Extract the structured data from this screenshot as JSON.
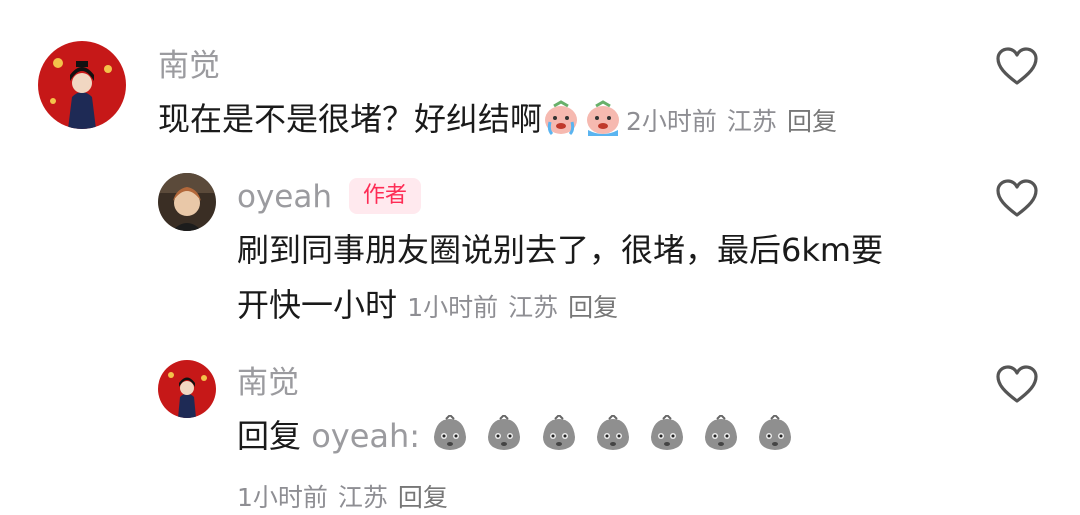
{
  "comments": [
    {
      "username": "南觉",
      "text": "现在是不是很堵？好纠结啊",
      "emojis": [
        "crying-face-emoji",
        "crying-face-emoji"
      ],
      "time": "2小时前",
      "location": "江苏",
      "reply_label": "回复"
    },
    {
      "username": "oyeah",
      "badge": "作者",
      "text_line1": "刷到同事朋友圈说别去了，很堵，最后6km要",
      "text_line2": "开快一小时",
      "time": "1小时前",
      "location": "江苏",
      "reply_label": "回复"
    },
    {
      "username": "南觉",
      "reply_prefix": "回复",
      "mention": "oyeah:",
      "emojis": [
        "sweating-face-emoji",
        "sweating-face-emoji",
        "sweating-face-emoji",
        "sweating-face-emoji",
        "sweating-face-emoji",
        "sweating-face-emoji",
        "sweating-face-emoji"
      ],
      "time": "1小时前",
      "location": "江苏",
      "reply_label": "回复"
    }
  ],
  "colors": {
    "accent": "#fe2c55",
    "username": "#9b9b9f",
    "meta": "#8e8e93"
  }
}
